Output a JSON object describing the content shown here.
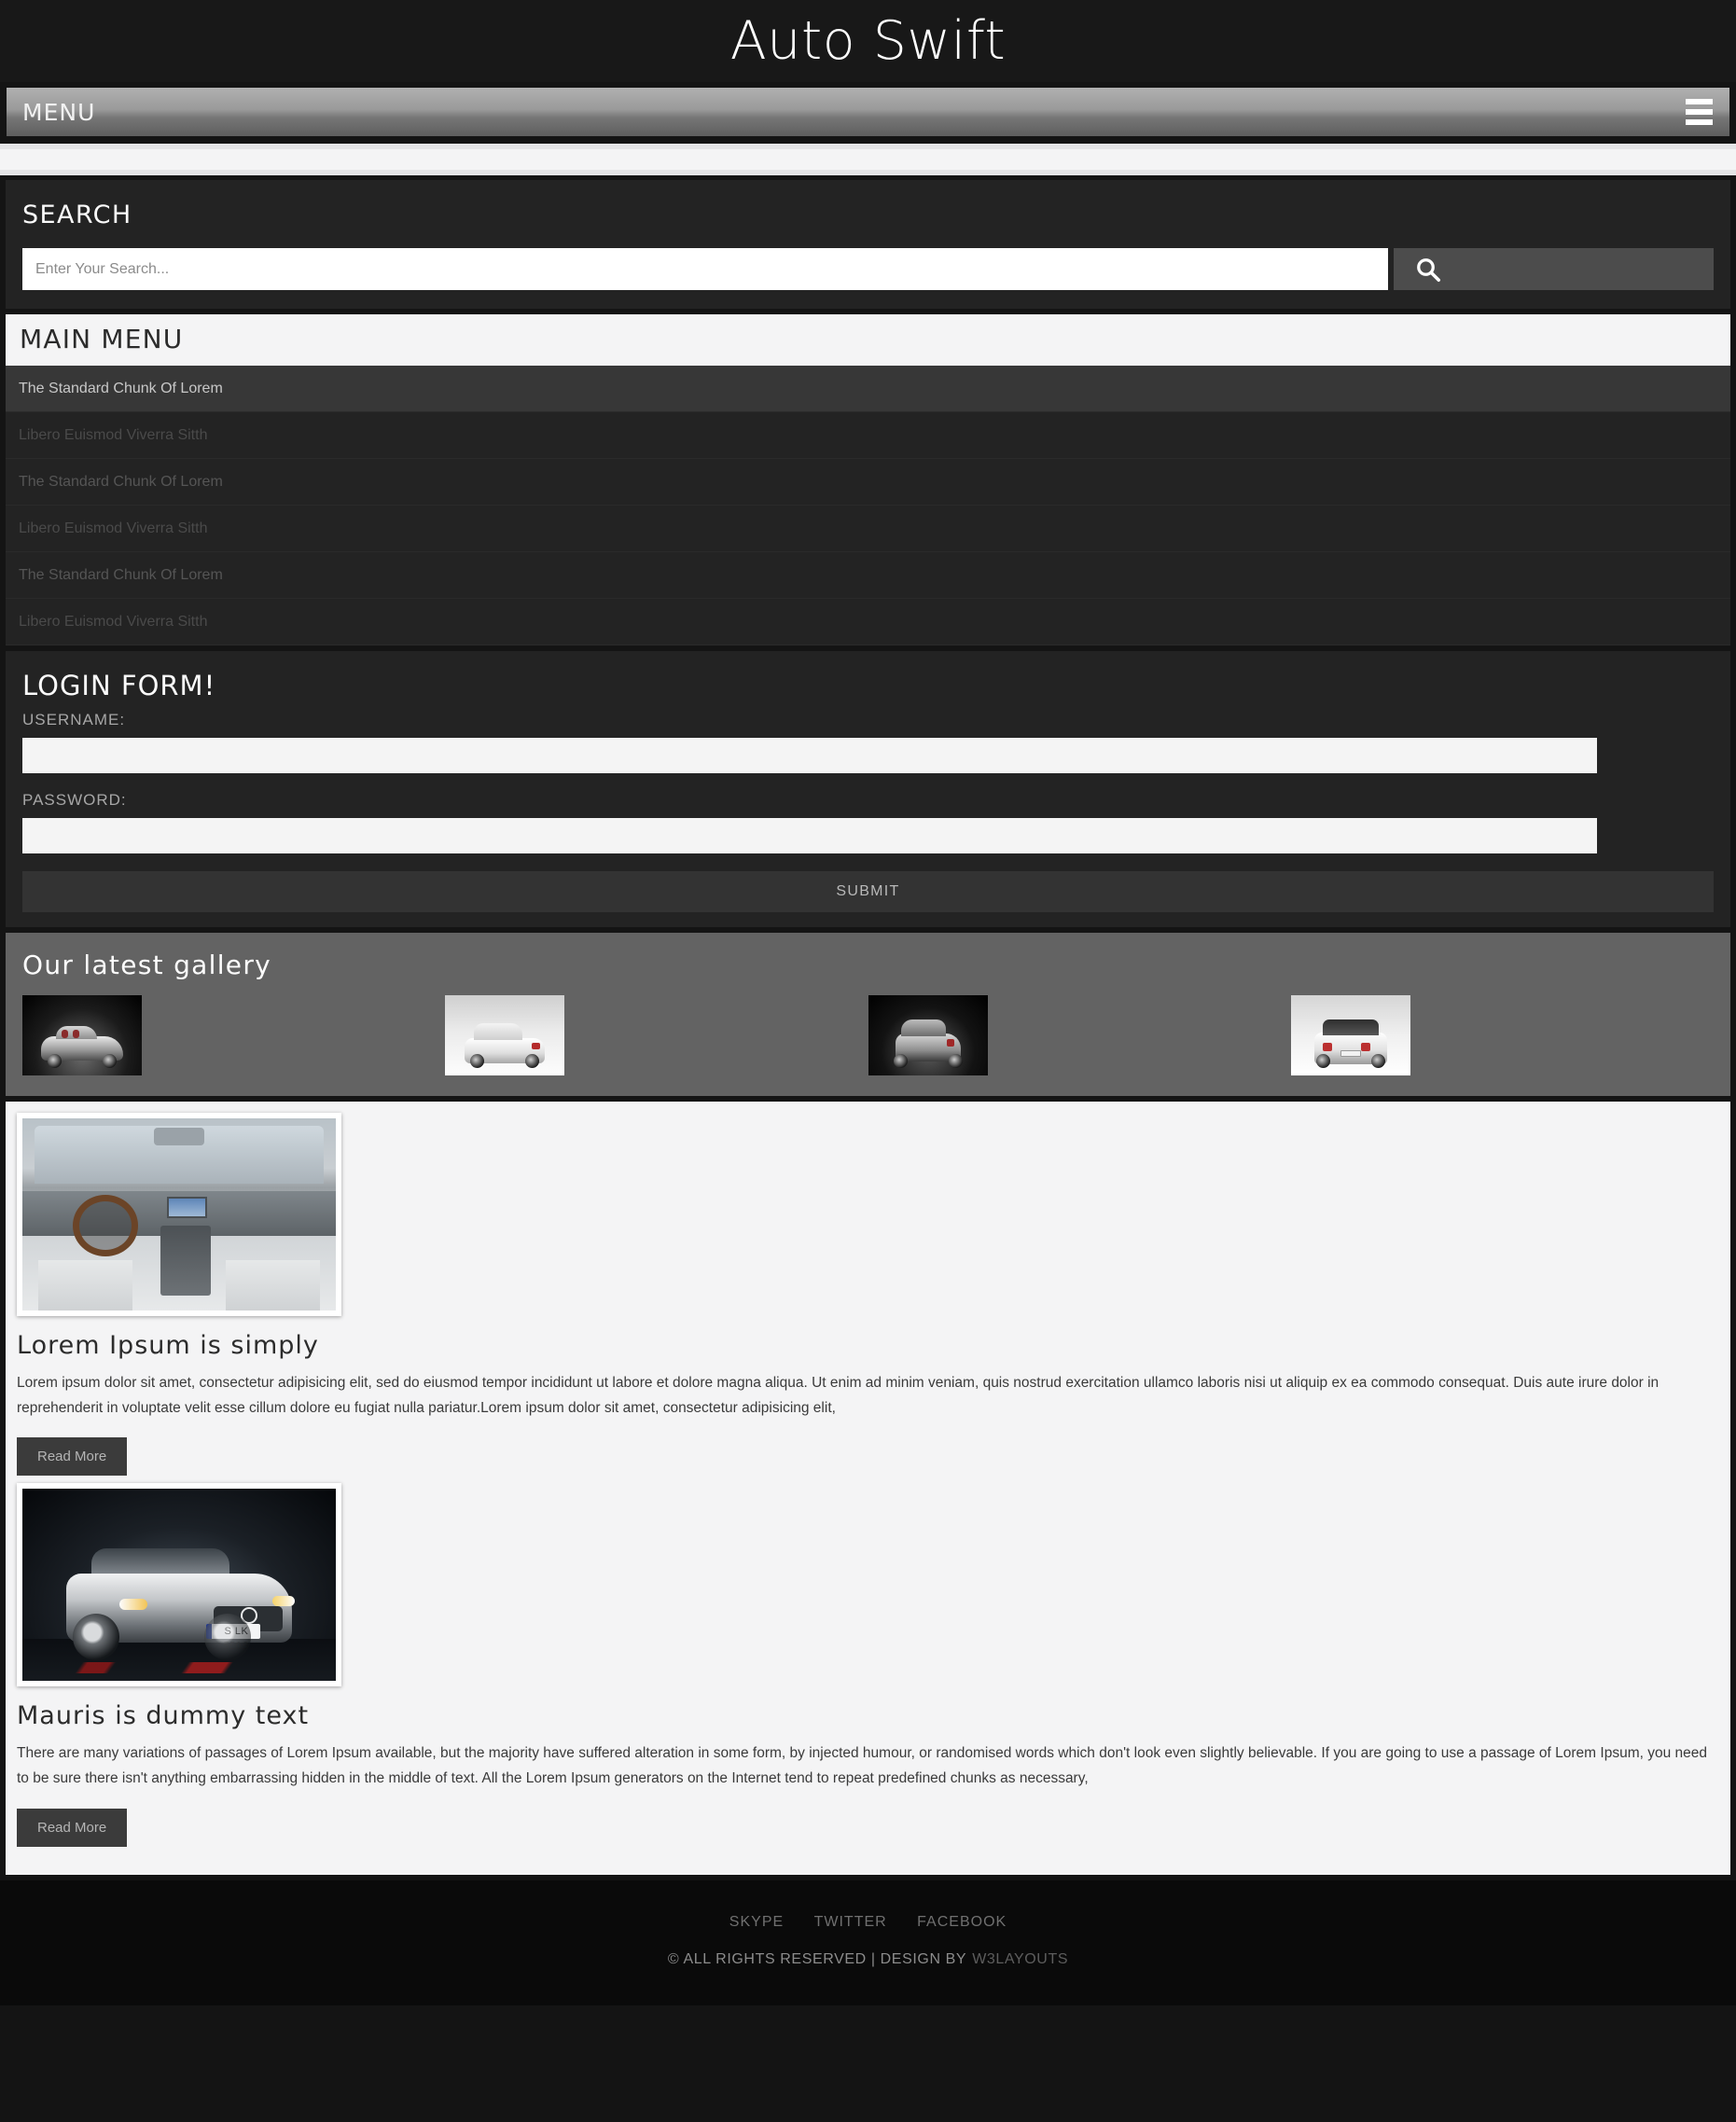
{
  "header": {
    "logo": "Auto Swift"
  },
  "navbar": {
    "menu_label": "MENU",
    "toggle_icon": "hamburger-icon"
  },
  "search": {
    "title": "SEARCH",
    "placeholder": "Enter Your Search...",
    "value": "",
    "button_icon": "search-icon"
  },
  "main_menu": {
    "title": "MAIN MENU",
    "items": [
      {
        "label": "The Standard Chunk Of Lorem",
        "state": "active"
      },
      {
        "label": "Libero Euismod Viverra Sitth",
        "state": "normal"
      },
      {
        "label": "The Standard Chunk Of Lorem",
        "state": "normal"
      },
      {
        "label": "Libero Euismod Viverra Sitth",
        "state": "normal"
      },
      {
        "label": "The Standard Chunk Of Lorem",
        "state": "normal"
      },
      {
        "label": "Libero Euismod Viverra Sitth",
        "state": "normal"
      }
    ]
  },
  "login": {
    "title": "LOGIN FORM!",
    "username_label": "USERNAME:",
    "username_value": "",
    "password_label": "PASSWORD:",
    "password_value": "",
    "submit_label": "SUBMIT"
  },
  "gallery": {
    "title": "Our latest gallery",
    "items": [
      {
        "alt": "silver-roadster-concept-car"
      },
      {
        "alt": "white-hatchback-rear-three-quarter"
      },
      {
        "alt": "silver-compact-car-dark-background"
      },
      {
        "alt": "white-compact-car-rear-view"
      }
    ]
  },
  "articles": [
    {
      "image_alt": "car-interior-dashboard-steering-wheel",
      "title": "Lorem Ipsum is simply",
      "body": "Lorem ipsum dolor sit amet, consectetur adipisicing elit, sed do eiusmod tempor incididunt ut labore et dolore magna aliqua. Ut enim ad minim veniam, quis nostrud exercitation ullamco laboris nisi ut aliquip ex ea commodo consequat. Duis aute irure dolor in reprehenderit in voluptate velit esse cillum dolore eu fugiat nulla pariatur.Lorem ipsum dolor sit amet, consectetur adipisicing elit,",
      "button_label": "Read More"
    },
    {
      "image_alt": "silver-mercedes-slk-convertible",
      "image_plate": "S LK 550S",
      "title": "Mauris is dummy text",
      "body": "There are many variations of passages of Lorem Ipsum available, but the majority have suffered alteration in some form, by injected humour, or randomised words which don't look even slightly believable. If you are going to use a passage of Lorem Ipsum, you need to be sure there isn't anything embarrassing hidden in the middle of text. All the Lorem Ipsum generators on the Internet tend to repeat predefined chunks as necessary,",
      "button_label": "Read More"
    }
  ],
  "footer": {
    "social": [
      "SKYPE",
      "TWITTER",
      "FACEBOOK"
    ],
    "copyright": "© ALL RIGHTS RESERVED | DESIGN BY",
    "brand": "W3LAYOUTS"
  },
  "colors": {
    "page_bg": "#141414",
    "panel_bg": "#232323",
    "menu_active": "#373737",
    "gallery_bg": "#636363",
    "content_bg": "#f4f4f5",
    "accent_light": "#f4f4f5"
  }
}
